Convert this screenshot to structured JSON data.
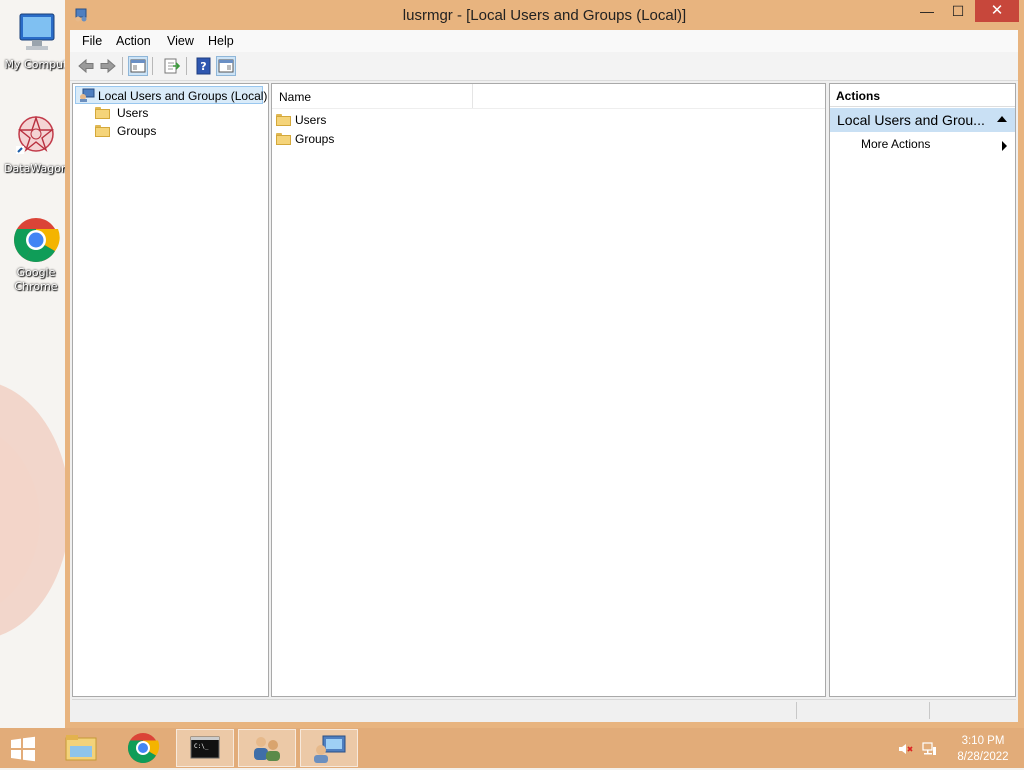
{
  "desktop": {
    "icons": [
      {
        "label": "My Comput"
      },
      {
        "label": "DataWagon"
      },
      {
        "label_line1": "Google",
        "label_line2": "Chrome"
      }
    ]
  },
  "window": {
    "title": "lusrmgr - [Local Users and Groups (Local)]",
    "minimize": "—",
    "maximize": "☐",
    "close": "✕",
    "accent": "#e8b47f"
  },
  "menu": {
    "file": "File",
    "action": "Action",
    "view": "View",
    "help": "Help"
  },
  "toolbar": {
    "icons": [
      "back-arrow-icon",
      "forward-arrow-icon",
      "show-hide-console-tree-icon",
      "export-list-icon",
      "help-icon",
      "show-hide-action-pane-icon"
    ]
  },
  "tree": {
    "root": "Local Users and Groups (Local)",
    "children": [
      "Users",
      "Groups"
    ]
  },
  "list": {
    "column_name": "Name",
    "rows": [
      "Users",
      "Groups"
    ]
  },
  "actions": {
    "header": "Actions",
    "section": "Local Users and Grou...",
    "more": "More Actions"
  },
  "taskbar": {
    "time": "3:10 PM",
    "date": "8/28/2022",
    "apps": [
      "file-explorer-icon",
      "chrome-icon",
      "command-prompt-icon",
      "users-groups-icon",
      "computer-management-icon"
    ]
  }
}
